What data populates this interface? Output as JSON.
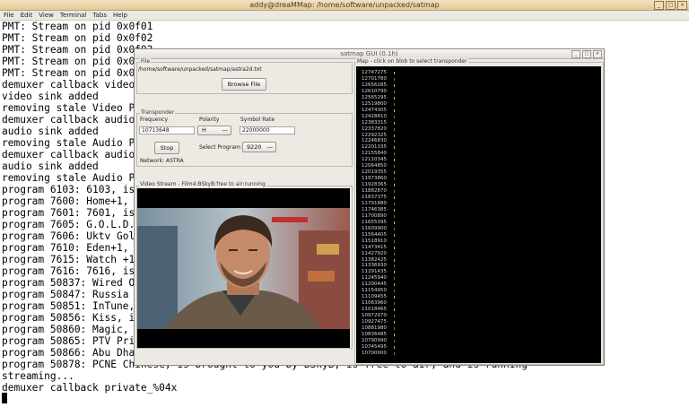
{
  "terminal": {
    "title": "addy@dreaMMap: /home/software/unpacked/satmap",
    "menu": [
      "File",
      "Edit",
      "View",
      "Terminal",
      "Tabs",
      "Help"
    ],
    "lines": [
      "PMT: Stream on pid 0x0f01",
      "PMT: Stream on pid 0x0f02",
      "PMT: Stream on pid 0x0f03",
      "PMT: Stream on pid 0x0f04",
      "PMT: Stream on pid 0x09",
      "demuxer callback video_",
      "video sink added",
      "removing stale Video PA",
      "demuxer callback audio_",
      "audio sink added",
      "removing stale Audio PA",
      "demuxer callback audio_",
      "audio sink added",
      "removing stale Audio PA",
      "program 6103: 6103, is",
      "program 7600: Home+1, i",
      "program 7601: 7601, is",
      "program 7605: G.O.L.D.",
      "program 7606: Uktv Gold",
      "program 7610: Eden+1, i",
      "program 7615: Watch +1,",
      "program 7616: 7616, is",
      "program 50837: Wired Oc",
      "program 50847: Russia T",
      "program 50851: InTune,",
      "program 50856: Kiss, is",
      "program 50860: Magic, i",
      "program 50865: PTV Prim",
      "program 50866: Abu Dhab",
      "program 50878: PCNE Chinese, is brought to you by BSkyB, is free to air, and is running",
      "streaming...",
      "demuxer callback private_%04x"
    ]
  },
  "satmap": {
    "title": "satmap GUI (0.1h)",
    "file_frame_label": "File",
    "file_path": "/home/software/unpacked/satmap/astra2d.txt",
    "browse_label": "Browse File",
    "transponder_label": "Transponder",
    "frequency_label": "Frequency",
    "frequency_value": "10713648",
    "polarity_label": "Polarity",
    "polarity_value": "H",
    "symbol_rate_label": "Symbol Rate",
    "symbol_rate_value": "22000000",
    "stop_label": "Stop",
    "select_program_label": "Select Program:",
    "select_program_value": "9220",
    "network_label": "Network: ASTRA",
    "video_label": "Video Stream - Film4:BSkyB:free to air:running",
    "map_label": "Map - click on blob to select transponder",
    "frequencies": [
      "12747275",
      "12701780",
      "12656285",
      "12610790",
      "12565295",
      "12519800",
      "12474305",
      "12428810",
      "12383315",
      "12337820",
      "12292325",
      "12246830",
      "12201335",
      "12155840",
      "12110345",
      "12064850",
      "12019355",
      "11973860",
      "11928365",
      "11882870",
      "11837375",
      "11791880",
      "11746385",
      "11700890",
      "11655395",
      "11609900",
      "11564405",
      "11518910",
      "11473415",
      "11427920",
      "11382425",
      "11336930",
      "11291435",
      "11245940",
      "11200445",
      "11154950",
      "11109455",
      "11063960",
      "11018465",
      "10972970",
      "10927475",
      "10881980",
      "10836485",
      "10790990",
      "10745495",
      "10700000"
    ]
  },
  "colors": {
    "blob_yellow": "#e0c020",
    "blob_green": "#2e9a3a",
    "terminal_titlebar": "#e4c894"
  }
}
